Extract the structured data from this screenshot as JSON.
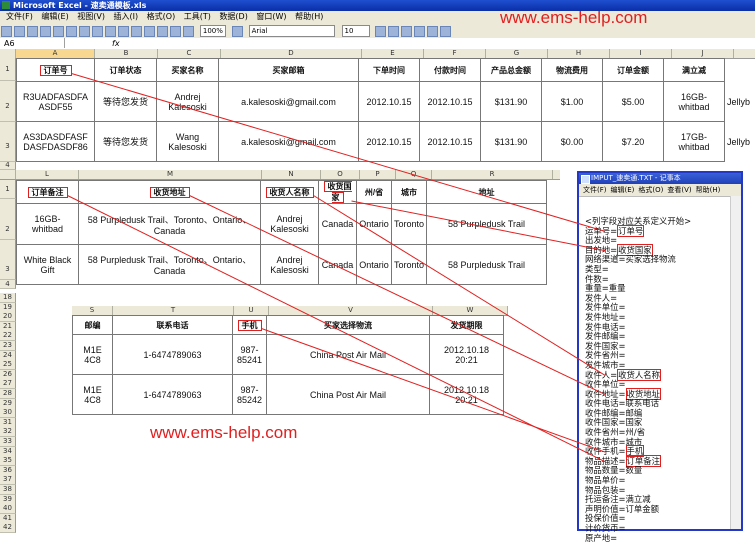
{
  "window_title": "Microsoft Excel - 速卖通模板.xls",
  "menu": [
    "文件(F)",
    "编辑(E)",
    "视图(V)",
    "插入(I)",
    "格式(O)",
    "工具(T)",
    "数据(D)",
    "窗口(W)",
    "帮助(H)"
  ],
  "toolbar": {
    "zoom": "100%",
    "font": "Arial",
    "font_size": "10"
  },
  "formula_bar": {
    "name_box": "A6",
    "fx": "fx"
  },
  "watermark_top": "www.ems-help.com",
  "watermark_bottom": "www.ems-help.com",
  "table1": {
    "columns": [
      "A",
      "B",
      "C",
      "D",
      "E",
      "F",
      "G",
      "H",
      "I",
      "J"
    ],
    "headers": [
      "订单号",
      "订单状态",
      "买家名称",
      "买家邮箱",
      "下单时间",
      "付款时间",
      "产品总金额",
      "物流费用",
      "订单金额",
      "满立减"
    ],
    "rows": [
      [
        "R3UADFASDFA\nASDF55",
        "等待您发货",
        "Andrej\nKalesoski",
        "a.kalesoski@gmail.com",
        "2012.10.15",
        "2012.10.15",
        "$131.90",
        "$1.00",
        "$5.00",
        "16GB-whitbad"
      ],
      [
        "AS3DASDFASF\nDASFDASDF86",
        "等待您发货",
        "Wang\nKalesoski",
        "a.kalesoski@gmail.com",
        "2012.10.15",
        "2012.10.15",
        "$131.90",
        "$0.00",
        "$7.20",
        "17GB-whitbad"
      ]
    ],
    "overflow": [
      "Jellyb",
      "Jellyb"
    ]
  },
  "table2": {
    "columns": [
      "L",
      "M",
      "N",
      "O",
      "P",
      "Q",
      "R"
    ],
    "headers": [
      "订单备注",
      "收货地址",
      "收货人名称",
      "收货国家",
      "州/省",
      "城市",
      "地址"
    ],
    "rows": [
      [
        "16GB-whitbad",
        "58 Purpledusk Trail、Toronto、Ontario、\nCanada",
        "Andrej\nKalesoski",
        "Canada",
        "Ontario",
        "Toronto",
        "58 Purpledusk Trail"
      ],
      [
        "White Black\nGift",
        "58 Purpledusk Trail、Toronto、Ontario、\nCanada",
        "Andrej\nKalesoski",
        "Canada",
        "Ontario",
        "Toronto",
        "58 Purpledusk Trail"
      ]
    ]
  },
  "table3": {
    "columns": [
      "S",
      "T",
      "U",
      "V",
      "W"
    ],
    "headers": [
      "邮编",
      "联系电话",
      "手机",
      "买家选择物流",
      "发货期限"
    ],
    "rows": [
      [
        "M1E\n4C8",
        "1-6474789063",
        "987-\n85241",
        "China Post Air Mail",
        "2012.10.18\n20:21"
      ],
      [
        "M1E\n4C8",
        "1-6474789063",
        "987-\n85242",
        "China Post Air Mail",
        "2012.10.18\n20:21"
      ]
    ]
  },
  "row_numbers_top": [
    "1",
    "2",
    "3",
    "4"
  ],
  "row_numbers_mid": [
    "1",
    "2",
    "3",
    "4"
  ],
  "row_numbers_bottom": [
    "18",
    "19",
    "20",
    "21",
    "22",
    "23",
    "24",
    "25",
    "26",
    "27",
    "28",
    "29",
    "30",
    "31",
    "32",
    "33",
    "34",
    "35",
    "36",
    "37",
    "38",
    "39",
    "40",
    "41",
    "42"
  ],
  "notepad": {
    "title": "IMPUT_速卖通.TXT - 记事本",
    "menu": [
      "文件(F)",
      "编辑(E)",
      "格式(O)",
      "查看(V)",
      "帮助(H)"
    ],
    "lines": [
      "<列字段对应关系定义开始>",
      "运单号=订单号",
      "出发地=",
      "目的地=收货国家",
      "网络渠道=买家选择物流",
      "类型=",
      "件数=",
      "重量=重量",
      "发件人=",
      "发件单位=",
      "发件地址=",
      "发件电话=",
      "发件邮编=",
      "发件国家=",
      "发件省州=",
      "发件城市=",
      "收件人=收货人名称",
      "收件单位=",
      "收件地址=收货地址",
      "收件电话=联系电话",
      "收件邮编=邮编",
      "收件国家=国家",
      "收件省州=州/省",
      "收件城市=城市",
      "收件手机=手机",
      "物品描述=订单备注",
      "物品数量=数量",
      "物品单价=",
      "物品包装=",
      "托运备注=满立减",
      "声明价值=订单金额",
      "投保价值=",
      "计价货币=",
      "原产地="
    ]
  }
}
